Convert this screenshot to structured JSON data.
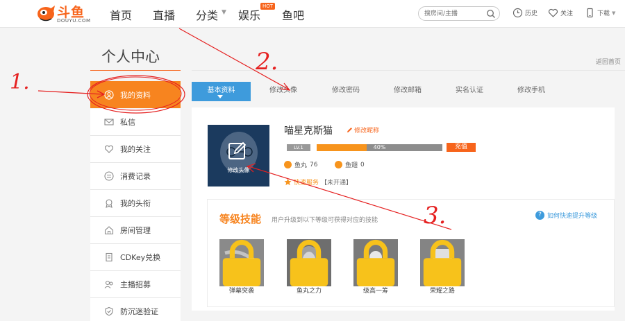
{
  "brand": {
    "name": "斗鱼",
    "sub": "DOUYU.COM",
    "color": "#f7641b"
  },
  "nav": {
    "items": [
      "首页",
      "直播",
      "分类",
      "娱乐",
      "鱼吧"
    ],
    "hot_badge": "HOT"
  },
  "search": {
    "placeholder": "搜房间/主播",
    "icon": "search-icon"
  },
  "tools": {
    "history": "历史",
    "follow": "关注",
    "download": "下载"
  },
  "page": {
    "title": "个人中心",
    "back_home": "返回首页"
  },
  "sidebar": {
    "items": [
      {
        "label": "我的资料",
        "icon": "user-circle-icon",
        "active": true
      },
      {
        "label": "私信",
        "icon": "mail-icon"
      },
      {
        "label": "我的关注",
        "icon": "heart-icon"
      },
      {
        "label": "消费记录",
        "icon": "record-icon"
      },
      {
        "label": "我的头衔",
        "icon": "medal-icon"
      },
      {
        "label": "房间管理",
        "icon": "house-icon"
      },
      {
        "label": "CDKey兑换",
        "icon": "key-icon"
      },
      {
        "label": "主播招募",
        "icon": "recruit-icon"
      },
      {
        "label": "防沉迷验证",
        "icon": "shield-icon"
      }
    ]
  },
  "tabs": [
    "基本资料",
    "修改头像",
    "修改密码",
    "修改邮箱",
    "实名认证",
    "修改手机"
  ],
  "profile": {
    "avatar_label": "修改头像",
    "username": "喵星克斯猫",
    "edit_nick": "修改昵称",
    "level": "LV.1",
    "exp_percent": 40,
    "exp_text": "40%",
    "recharge": "充值",
    "yuwan_label": "鱼丸",
    "yuwan_value": "76",
    "yuchi_label": "鱼翅",
    "yuchi_value": "0",
    "service_link": "快速服务",
    "service_status": "【未开通】"
  },
  "skills": {
    "title": "等级技能",
    "desc": "用户升级到以下等级可获得对应的技能",
    "help": "如何快速提升等级",
    "items": [
      {
        "name": "弹幕突袭"
      },
      {
        "name": "鱼丸之力"
      },
      {
        "name": "级高一筹"
      },
      {
        "name": "荣耀之路"
      }
    ]
  },
  "annotations": [
    "1.",
    "2.",
    "3."
  ],
  "colors": {
    "accent": "#f7841f",
    "tab_active": "#3e9bdc",
    "annotation": "#e52020"
  }
}
